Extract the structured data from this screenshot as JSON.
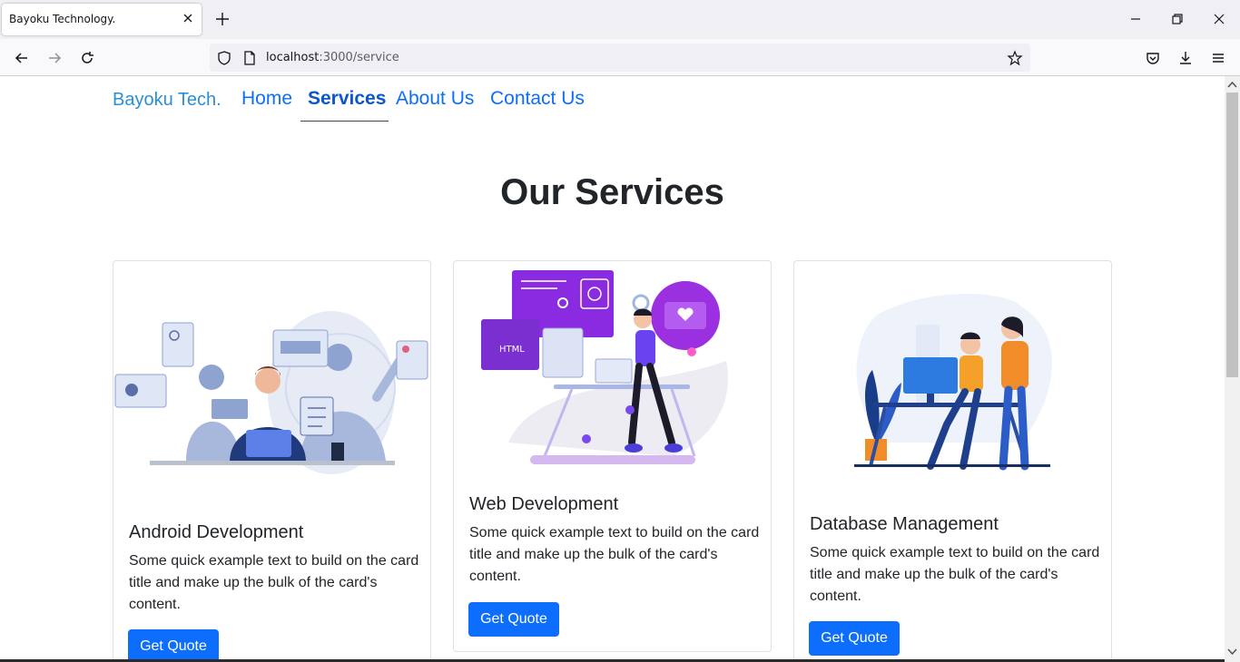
{
  "browser": {
    "tab_title": "Bayoku Technology.",
    "url_host": "localhost",
    "url_rest": ":3000/service"
  },
  "site": {
    "brand": "Bayoku Tech.",
    "nav": [
      {
        "label": "Home"
      },
      {
        "label": "Services"
      },
      {
        "label": "About Us"
      },
      {
        "label": "Contact Us"
      }
    ],
    "active_nav": "Services"
  },
  "main": {
    "title": "Our Services",
    "cards": [
      {
        "title": "Android Development",
        "text": "Some quick example text to build on the card title and make up the bulk of the card's content.",
        "button": "Get Quote",
        "illustration": "team-developers-illustration"
      },
      {
        "title": "Web Development",
        "text": "Some quick example text to build on the card title and make up the bulk of the card's content.",
        "button": "Get Quote",
        "illustration": "web-developer-illustration",
        "html_badge": "HTML"
      },
      {
        "title": "Database Management",
        "text": "Some quick example text to build on the card title and make up the bulk of the card's content.",
        "button": "Get Quote",
        "illustration": "office-workers-illustration"
      }
    ]
  },
  "colors": {
    "primary": "#0d6efd",
    "brand": "#2a8fd6",
    "text": "#212529"
  }
}
